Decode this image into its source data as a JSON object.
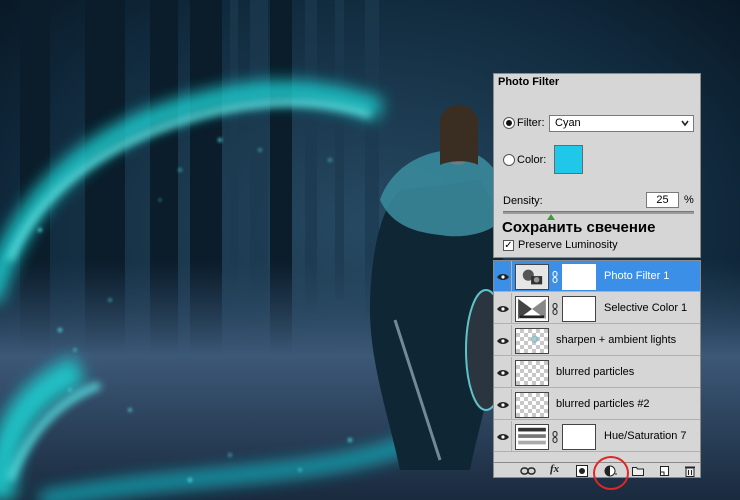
{
  "photo_filter": {
    "title": "Photo Filter",
    "filter_label": "Filter:",
    "filter_value": "Cyan",
    "filter_selected": true,
    "color_label": "Color:",
    "color_value": "#1fc8e8",
    "density_label": "Density:",
    "density_value": "25",
    "density_unit": "%",
    "density_fraction": 0.25,
    "overlay_text": "Сохранить свечение",
    "preserve_luminosity_label": "Preserve Luminosity",
    "preserve_luminosity_checked": true
  },
  "layers": {
    "items": [
      {
        "name": "Photo Filter 1",
        "selected": true,
        "thumb": "photo-filter-icon",
        "has_mask": true,
        "visible": true
      },
      {
        "name": "Selective Color 1",
        "selected": false,
        "thumb": "selective-color-icon",
        "has_mask": true,
        "visible": true
      },
      {
        "name": "sharpen + ambient lights",
        "selected": false,
        "thumb": "transparent",
        "has_mask": false,
        "visible": true
      },
      {
        "name": "blurred particles",
        "selected": false,
        "thumb": "transparent",
        "has_mask": false,
        "visible": true
      },
      {
        "name": "blurred particles #2",
        "selected": false,
        "thumb": "transparent",
        "has_mask": false,
        "visible": true
      },
      {
        "name": "Hue/Saturation 7",
        "selected": false,
        "thumb": "hue-saturation-icon",
        "has_mask": true,
        "visible": true
      }
    ],
    "toolbar": {
      "fx_label": "fx",
      "icons": [
        "link-layers-icon",
        "fx-icon",
        "add-mask-icon",
        "adjustment-layer-icon",
        "new-group-icon",
        "new-layer-icon",
        "trash-icon"
      ]
    },
    "highlight_color": "#e02626",
    "selected_color": "#3b8fe6"
  }
}
